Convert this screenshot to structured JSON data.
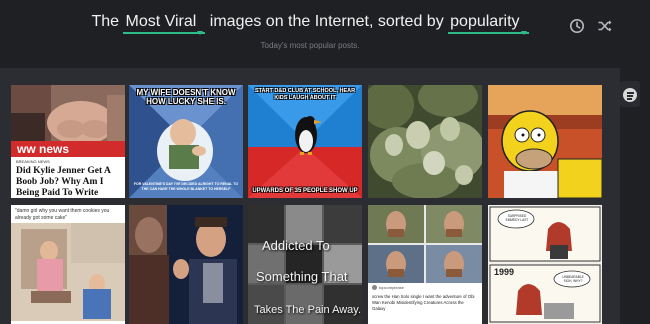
{
  "header": {
    "prefix": "The",
    "sort_subject": "Most Viral",
    "middle": "images on the Internet, sorted by",
    "sort_by": "popularity",
    "subtitle": "Today's most popular posts.",
    "accent_color": "#2dbb8a",
    "icons": [
      "clock-icon",
      "shuffle-icon"
    ]
  },
  "sidebar": {
    "icon": "chat-bubble-icon"
  },
  "posts": [
    {
      "badge": "ww news",
      "label": "BREAKING NEWS",
      "title": "Did Kylie Jenner Get A Boob Job? Why Am I Being Paid To Write"
    },
    {
      "top": "MY WIFE DOESN'T KNOW HOW LUCKY SHE IS.",
      "bottom": "FOR VALENTINE'S DAY I'VE DECIDED ALRIGHT TO RENAL TO THE CAN HAVE THE WHOLE BLANKET TO HERSELF"
    },
    {
      "top": "START D&D CLUB AT SCHOOL, HEAR KIDS LAUGH ABOUT IT",
      "bottom": "UPWARDS OF 35 PEOPLE SHOW UP"
    },
    {},
    {},
    {
      "quote": "\"damn girl why you want them cookies you already got some cake\""
    },
    {},
    {
      "lines": [
        "Addicted To",
        "Something That",
        "Takes The Pain Away."
      ]
    },
    {
      "handle": "topcomplease",
      "text": "screw the Han Solo single I want the adventure of Obi Wan Kenobi Misidentifying Creatures Across the Galaxy"
    },
    {
      "bubble1": "SURPRISED EMMEDY LAST",
      "year": "1999",
      "bubble2": "UNBEARABLE SIGH, WHY?"
    }
  ]
}
